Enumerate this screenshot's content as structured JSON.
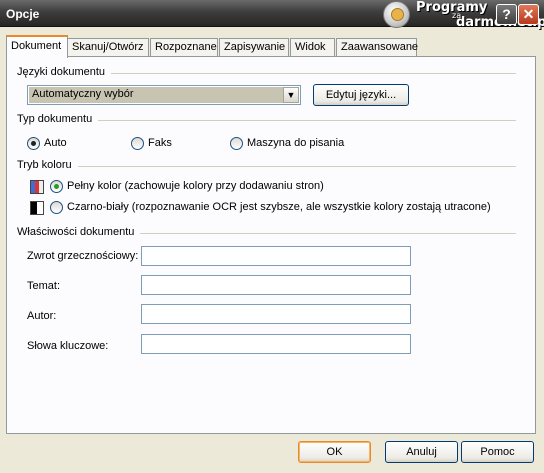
{
  "window": {
    "title": "Opcje",
    "watermark": {
      "line1": "Programy",
      "line2": "za",
      "line3": "darmo.net.pl"
    },
    "help_label": "?",
    "close_label": "✕"
  },
  "tabs": [
    {
      "label": "Dokument",
      "active": true
    },
    {
      "label": "Skanuj/Otwórz"
    },
    {
      "label": "Rozpoznane"
    },
    {
      "label": "Zapisywanie"
    },
    {
      "label": "Widok"
    },
    {
      "label": "Zaawansowane"
    }
  ],
  "languages": {
    "group_label": "Języki dokumentu",
    "selected": "Automatyczny wybór",
    "edit_button": "Edytuj języki..."
  },
  "doc_type": {
    "group_label": "Typ dokumentu",
    "options": [
      {
        "label": "Auto",
        "checked": true
      },
      {
        "label": "Faks",
        "checked": false
      },
      {
        "label": "Maszyna do pisania",
        "checked": false
      }
    ]
  },
  "color_mode": {
    "group_label": "Tryb koloru",
    "options": [
      {
        "label": "Pełny kolor (zachowuje kolory przy dodawaniu stron)",
        "checked": true,
        "icon": "full-color-icon"
      },
      {
        "label": "Czarno-biały (rozpoznawanie OCR jest szybsze, ale wszystkie kolory zostają utracone)",
        "checked": false,
        "icon": "black-white-icon"
      }
    ]
  },
  "properties": {
    "group_label": "Właściwości dokumentu",
    "fields": [
      {
        "label": "Zwrot grzecznościowy:",
        "value": ""
      },
      {
        "label": "Temat:",
        "value": ""
      },
      {
        "label": "Autor:",
        "value": ""
      },
      {
        "label": "Słowa kluczowe:",
        "value": ""
      }
    ]
  },
  "footer": {
    "ok": "OK",
    "cancel": "Anuluj",
    "help": "Pomoc"
  },
  "colors": {
    "titlebar": "#3e3e3e",
    "tab_accent": "#e68b2c",
    "dialog_bg": "#ece9d8",
    "panel_bg": "#fcfcfe",
    "selection_bg": "#c7c5b2",
    "radio_checked": "#21a121"
  }
}
